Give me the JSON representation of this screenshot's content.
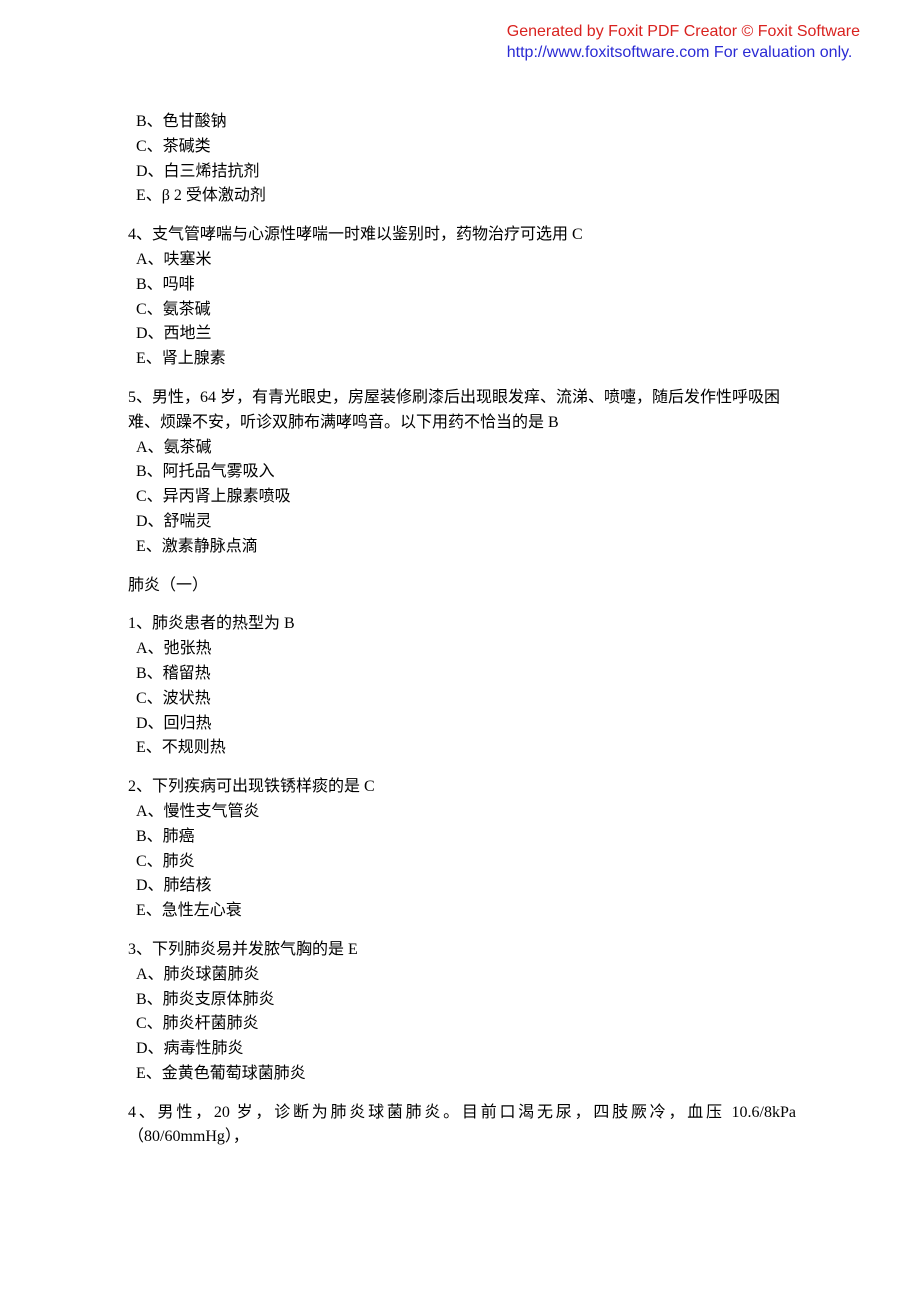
{
  "watermark": {
    "line1": "Generated by Foxit PDF Creator © Foxit Software",
    "line2": "http://www.foxitsoftware.com   For evaluation only."
  },
  "leading_options": {
    "B": "B、色甘酸钠",
    "C": "C、茶碱类",
    "D": "D、白三烯拮抗剂",
    "E": "E、β  2  受体激动剂"
  },
  "q4a": {
    "text": "4、支气管哮喘与心源性哮喘一时难以鉴别时，药物治疗可选用 C",
    "A": "A、呋塞米",
    "B": "B、吗啡",
    "C": "C、氨茶碱",
    "D": "D、西地兰",
    "E": "E、肾上腺素"
  },
  "q5a": {
    "text": "5、男性，64 岁，有青光眼史，房屋装修刷漆后出现眼发痒、流涕、喷嚏，随后发作性呼吸困难、烦躁不安，听诊双肺布满哮鸣音。以下用药不恰当的是 B",
    "A": "A、氨茶碱",
    "B": "B、阿托品气雾吸入",
    "C": "C、异丙肾上腺素喷吸",
    "D": "D、舒喘灵",
    "E": "E、激素静脉点滴"
  },
  "section_title": "肺炎（一）",
  "q1b": {
    "text": "1、肺炎患者的热型为 B",
    "A": "A、弛张热",
    "B": "B、稽留热",
    "C": "C、波状热",
    "D": "D、回归热",
    "E": "E、不规则热"
  },
  "q2b": {
    "text": "2、下列疾病可出现铁锈样痰的是 C",
    "A": "A、慢性支气管炎",
    "B": "B、肺癌",
    "C": "C、肺炎",
    "D": "D、肺结核",
    "E": "E、急性左心衰"
  },
  "q3b": {
    "text": "3、下列肺炎易并发脓气胸的是 E",
    "A": "A、肺炎球菌肺炎",
    "B": "B、肺炎支原体肺炎",
    "C": "C、肺炎杆菌肺炎",
    "D": "D、病毒性肺炎",
    "E": "E、金黄色葡萄球菌肺炎"
  },
  "q4b": {
    "text": "4、男性，20 岁，诊断为肺炎球菌肺炎。目前口渴无尿，四肢厥冷，血压 10.6/8kPa（80/60mmHg），"
  }
}
